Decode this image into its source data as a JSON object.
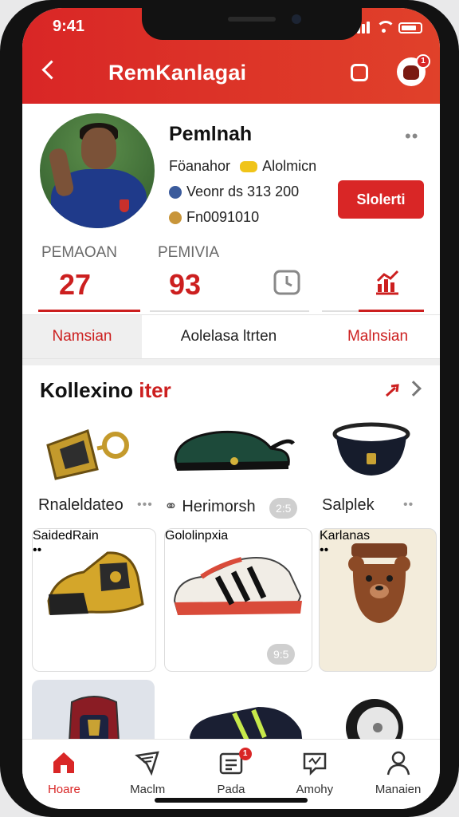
{
  "status": {
    "time": "9:41"
  },
  "header": {
    "title": "RemKanlagai",
    "notif_count": "1"
  },
  "profile": {
    "name": "Pemlnah",
    "info": [
      {
        "label": "Föanahor",
        "extra": "Alolmicn"
      },
      {
        "label": "Veonr ds 313 200"
      },
      {
        "label": "Fn0091010"
      }
    ],
    "cta_label": "Slolerti"
  },
  "stats": [
    {
      "label": "PEMAOAN",
      "value": "27"
    },
    {
      "label": "PEMIVIA",
      "value": "93"
    }
  ],
  "tabs": [
    "Namsian",
    "Aolelasa ltrten",
    "Malnsian"
  ],
  "collection": {
    "title": "Kollexino",
    "title_accent": "iter",
    "items": [
      {
        "label": "Rnaleldateo",
        "pill": ""
      },
      {
        "label": "Herimorsh",
        "pill": "2:5"
      },
      {
        "label": "Salplek",
        "pill": ""
      },
      {
        "label": "SaidedRain",
        "pill": ""
      },
      {
        "label": "Gololinpxia",
        "pill": "9:5"
      },
      {
        "label": "Karlanas",
        "pill": ""
      }
    ]
  },
  "nav": {
    "items": [
      "Hoare",
      "Maclm",
      "Pada",
      "Amohy",
      "Manaien"
    ],
    "badge": "1"
  },
  "colors": {
    "accent": "#d92626",
    "header_gradient_end": "#e0412a"
  }
}
